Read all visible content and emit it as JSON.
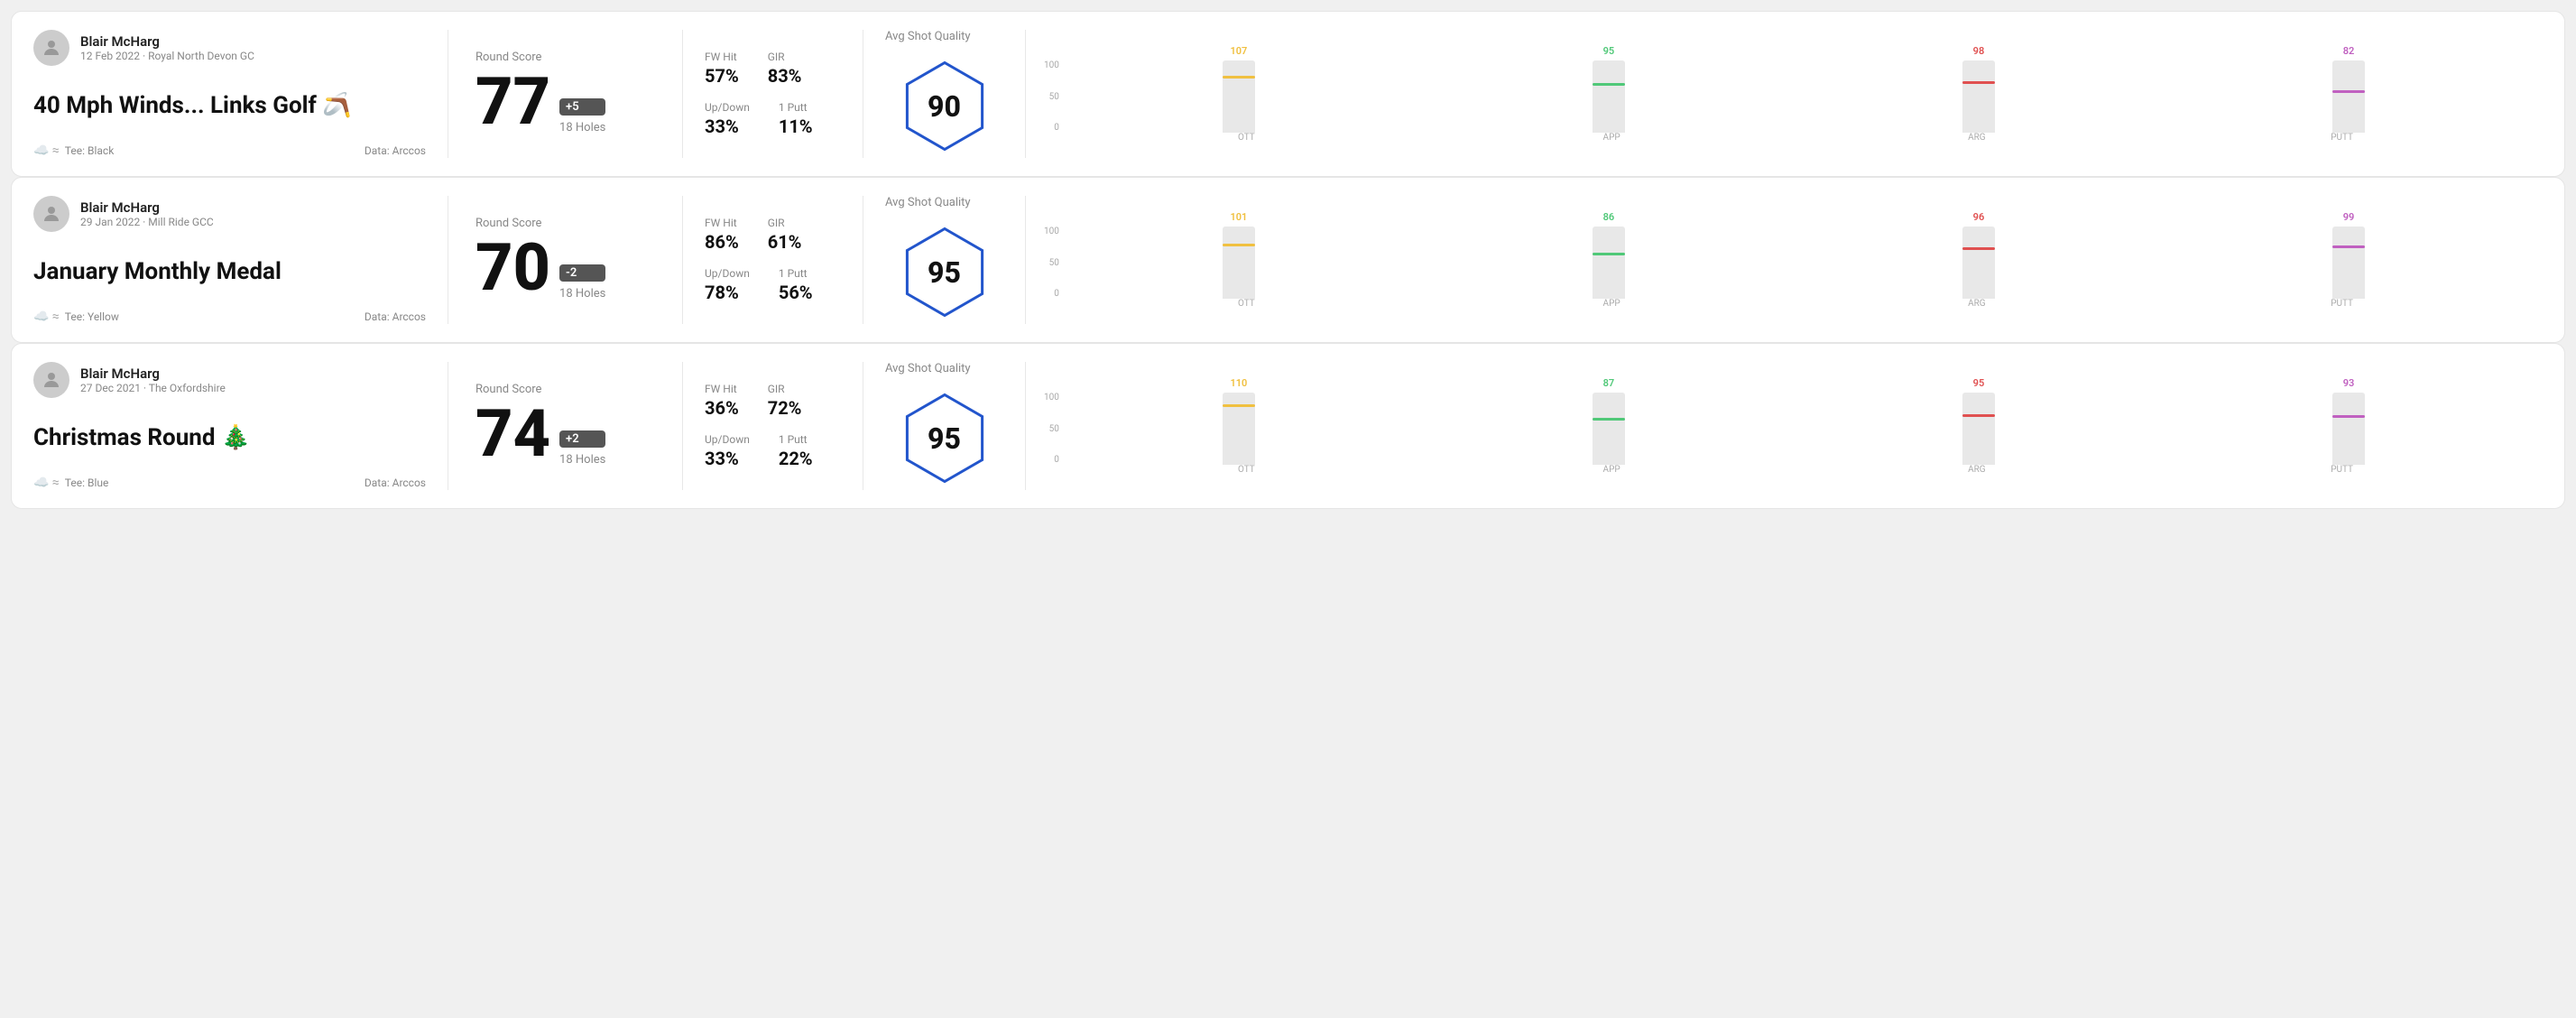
{
  "rounds": [
    {
      "id": "round-1",
      "user": {
        "name": "Blair McHarg",
        "meta": "12 Feb 2022 · Royal North Devon GC"
      },
      "title": "40 Mph Winds... Links Golf",
      "titleEmoji": "🪃",
      "tee": "Black",
      "dataSource": "Data: Arccos",
      "score": {
        "label": "Round Score",
        "number": "77",
        "badge": "+5",
        "badgeType": "positive",
        "holes": "18 Holes"
      },
      "stats": {
        "fwHit": {
          "label": "FW Hit",
          "value": "57%"
        },
        "gir": {
          "label": "GIR",
          "value": "83%"
        },
        "upDown": {
          "label": "Up/Down",
          "value": "33%"
        },
        "onePutt": {
          "label": "1 Putt",
          "value": "11%"
        }
      },
      "quality": {
        "label": "Avg Shot Quality",
        "value": "90"
      },
      "chart": {
        "bars": [
          {
            "label": "OTT",
            "value": 107,
            "color": "#f0c040",
            "pct": 75
          },
          {
            "label": "APP",
            "value": 95,
            "color": "#50c878",
            "pct": 65
          },
          {
            "label": "ARG",
            "value": 98,
            "color": "#e05050",
            "pct": 68
          },
          {
            "label": "PUTT",
            "value": 82,
            "color": "#c060c0",
            "pct": 55
          }
        ],
        "yLabels": [
          "100",
          "50",
          "0"
        ]
      }
    },
    {
      "id": "round-2",
      "user": {
        "name": "Blair McHarg",
        "meta": "29 Jan 2022 · Mill Ride GCC"
      },
      "title": "January Monthly Medal",
      "titleEmoji": "",
      "tee": "Yellow",
      "dataSource": "Data: Arccos",
      "score": {
        "label": "Round Score",
        "number": "70",
        "badge": "-2",
        "badgeType": "negative",
        "holes": "18 Holes"
      },
      "stats": {
        "fwHit": {
          "label": "FW Hit",
          "value": "86%"
        },
        "gir": {
          "label": "GIR",
          "value": "61%"
        },
        "upDown": {
          "label": "Up/Down",
          "value": "78%"
        },
        "onePutt": {
          "label": "1 Putt",
          "value": "56%"
        }
      },
      "quality": {
        "label": "Avg Shot Quality",
        "value": "95"
      },
      "chart": {
        "bars": [
          {
            "label": "OTT",
            "value": 101,
            "color": "#f0c040",
            "pct": 72
          },
          {
            "label": "APP",
            "value": 86,
            "color": "#50c878",
            "pct": 60
          },
          {
            "label": "ARG",
            "value": 96,
            "color": "#e05050",
            "pct": 67
          },
          {
            "label": "PUTT",
            "value": 99,
            "color": "#c060c0",
            "pct": 70
          }
        ],
        "yLabels": [
          "100",
          "50",
          "0"
        ]
      }
    },
    {
      "id": "round-3",
      "user": {
        "name": "Blair McHarg",
        "meta": "27 Dec 2021 · The Oxfordshire"
      },
      "title": "Christmas Round",
      "titleEmoji": "🎄",
      "tee": "Blue",
      "dataSource": "Data: Arccos",
      "score": {
        "label": "Round Score",
        "number": "74",
        "badge": "+2",
        "badgeType": "positive",
        "holes": "18 Holes"
      },
      "stats": {
        "fwHit": {
          "label": "FW Hit",
          "value": "36%"
        },
        "gir": {
          "label": "GIR",
          "value": "72%"
        },
        "upDown": {
          "label": "Up/Down",
          "value": "33%"
        },
        "onePutt": {
          "label": "1 Putt",
          "value": "22%"
        }
      },
      "quality": {
        "label": "Avg Shot Quality",
        "value": "95"
      },
      "chart": {
        "bars": [
          {
            "label": "OTT",
            "value": 110,
            "color": "#f0c040",
            "pct": 80
          },
          {
            "label": "APP",
            "value": 87,
            "color": "#50c878",
            "pct": 61
          },
          {
            "label": "ARG",
            "value": 95,
            "color": "#e05050",
            "pct": 66
          },
          {
            "label": "PUTT",
            "value": 93,
            "color": "#c060c0",
            "pct": 65
          }
        ],
        "yLabels": [
          "100",
          "50",
          "0"
        ]
      }
    }
  ]
}
